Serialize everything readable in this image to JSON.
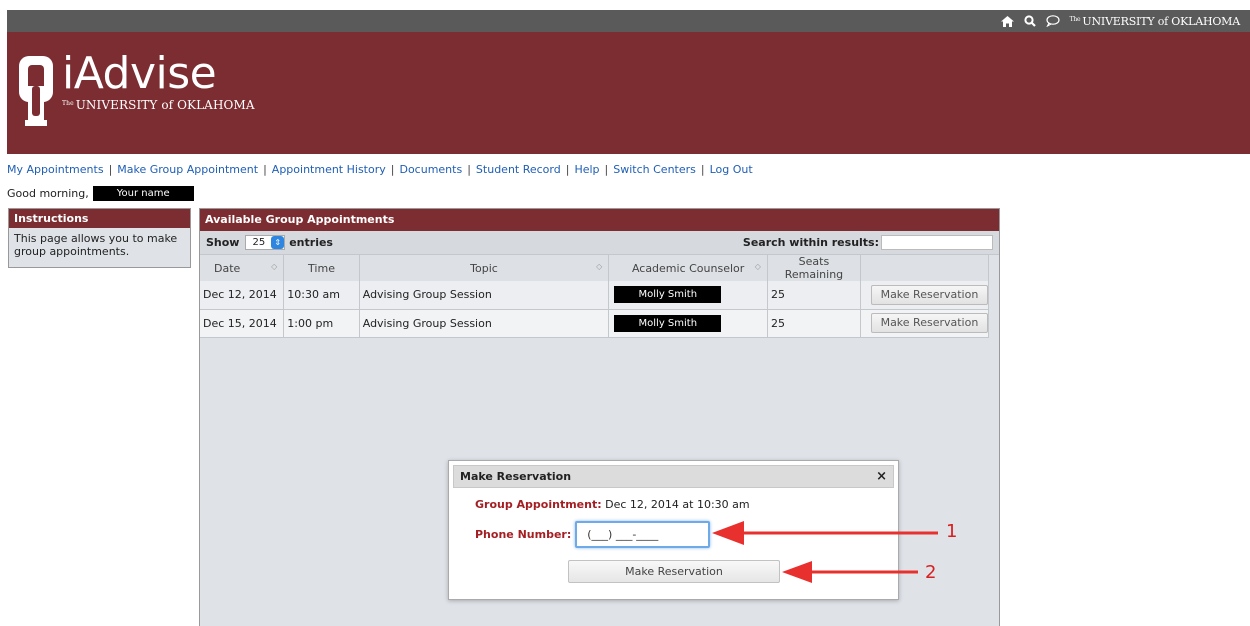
{
  "topbar": {
    "university": "UNIVERSITY of OKLAHOMA",
    "university_prefix": "The",
    "icons": [
      "home-icon",
      "search-icon",
      "chat-icon"
    ]
  },
  "header": {
    "brand": "iAdvise",
    "university": "UNIVERSITY of OKLAHOMA",
    "university_prefix": "The",
    "bg_color": "#7c2d31"
  },
  "nav": {
    "items": [
      {
        "label": "My Appointments"
      },
      {
        "label": "Make Group Appointment"
      },
      {
        "label": "Appointment History"
      },
      {
        "label": "Documents"
      },
      {
        "label": "Student Record"
      },
      {
        "label": "Help"
      },
      {
        "label": "Switch Centers"
      },
      {
        "label": "Log Out"
      }
    ]
  },
  "greeting": {
    "text": "Good morning,",
    "name": "Your name"
  },
  "instructions": {
    "title": "Instructions",
    "body": "This page allows you to make group appointments."
  },
  "appointments": {
    "title": "Available Group Appointments",
    "show_label": "Show",
    "show_value": "25",
    "entries_label": "entries",
    "search_label": "Search within results:",
    "columns": [
      "Date",
      "Time",
      "Topic",
      "Academic Counselor",
      "Seats Remaining",
      ""
    ],
    "rows": [
      {
        "date": "Dec 12, 2014",
        "time": "10:30 am",
        "topic": "Advising Group Session",
        "counselor": "Molly Smith",
        "seats": "25",
        "action": "Make Reservation"
      },
      {
        "date": "Dec 15, 2014",
        "time": "1:00 pm",
        "topic": "Advising Group Session",
        "counselor": "Molly Smith",
        "seats": "25",
        "action": "Make Reservation"
      }
    ]
  },
  "modal": {
    "title": "Make Reservation",
    "close": "×",
    "appt_label": "Group Appointment:",
    "appt_value": "Dec 12, 2014 at 10:30 am",
    "phone_label": "Phone Number:",
    "phone_value": "(___) ___-____",
    "button": "Make Reservation"
  },
  "annotations": {
    "callout_1": "1",
    "callout_2": "2",
    "color": "#d81e1e"
  }
}
